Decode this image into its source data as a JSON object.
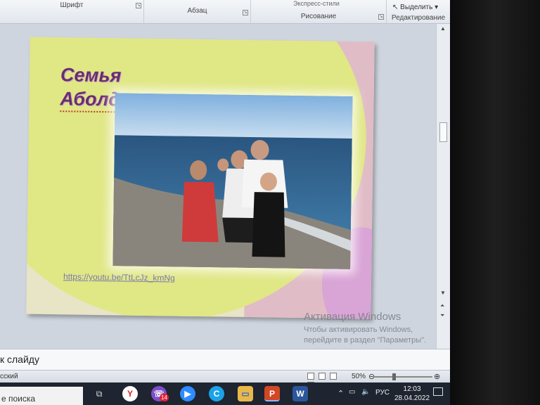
{
  "ribbon": {
    "groups": [
      "Шрифт",
      "Абзац",
      "Рисование",
      "Редактирование"
    ],
    "top_text": "Экспресс-стили",
    "select_label": "Выделить"
  },
  "slide": {
    "title_line1": "Семья",
    "title_line2": "Аболдуевых",
    "link": "https://youtu.be/TtLcJz_kmNg"
  },
  "activation": {
    "title": "Активация Windows",
    "line1": "Чтобы активировать Windows,",
    "line2": "перейдите в раздел \"Параметры\"."
  },
  "notes": {
    "label": "к слайду"
  },
  "status": {
    "language": "сский",
    "zoom": "50%"
  },
  "taskbar": {
    "search_text": "е поиска",
    "viber_badge": "14",
    "tray_lang": "РУС",
    "time": "12:03",
    "date": "28.04.2022"
  },
  "colors": {
    "slide_yellow": "#e0e785",
    "slide_pink": "#e0bcc6",
    "title_purple": "#6b2d71"
  }
}
